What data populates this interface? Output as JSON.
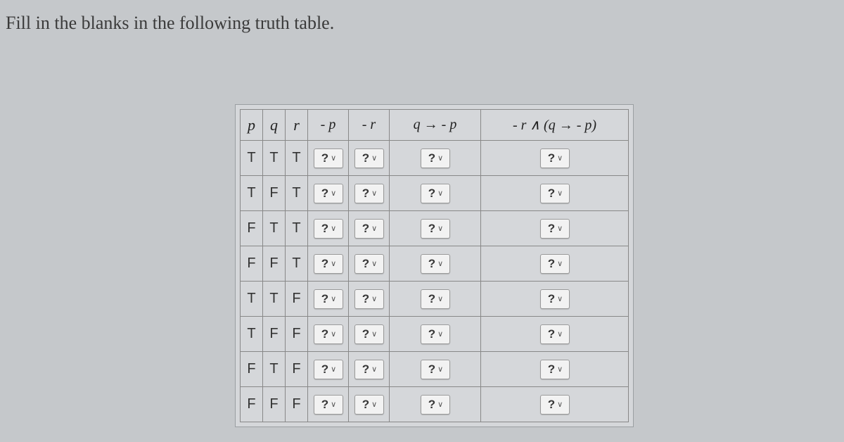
{
  "instruction": "Fill in the blanks in the following truth table.",
  "headers": {
    "p": "p",
    "q": "q",
    "r": "r",
    "not_p": "- p",
    "not_r": "- r",
    "q_imp_not_p": "q → - p",
    "final": "- r ∧ (q → - p)"
  },
  "dropdown_placeholder": "?",
  "rows": [
    {
      "p": "T",
      "q": "T",
      "r": "T"
    },
    {
      "p": "T",
      "q": "F",
      "r": "T"
    },
    {
      "p": "F",
      "q": "T",
      "r": "T"
    },
    {
      "p": "F",
      "q": "F",
      "r": "T"
    },
    {
      "p": "T",
      "q": "T",
      "r": "F"
    },
    {
      "p": "T",
      "q": "F",
      "r": "F"
    },
    {
      "p": "F",
      "q": "T",
      "r": "F"
    },
    {
      "p": "F",
      "q": "F",
      "r": "F"
    }
  ]
}
